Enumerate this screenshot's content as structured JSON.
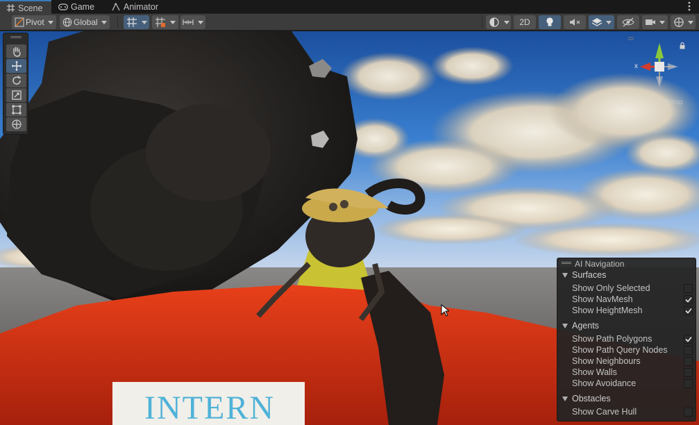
{
  "tabs": [
    {
      "label": "Scene",
      "icon": "grid-icon",
      "active": true
    },
    {
      "label": "Game",
      "icon": "gamepad-icon",
      "active": false
    },
    {
      "label": "Animator",
      "icon": "animator-icon",
      "active": false
    }
  ],
  "toolbar": {
    "pivot_label": "Pivot",
    "global_label": "Global",
    "mode_2d_label": "2D"
  },
  "scene": {
    "sign_text": "INTERN"
  },
  "ai_navigation": {
    "title": "AI Navigation",
    "sections": [
      {
        "label": "Surfaces",
        "options": [
          {
            "label": "Show Only Selected",
            "checked": false
          },
          {
            "label": "Show NavMesh",
            "checked": true
          },
          {
            "label": "Show HeightMesh",
            "checked": true
          }
        ]
      },
      {
        "label": "Agents",
        "options": [
          {
            "label": "Show Path Polygons",
            "checked": true
          },
          {
            "label": "Show Path Query Nodes",
            "checked": false
          },
          {
            "label": "Show Neighbours",
            "checked": false
          },
          {
            "label": "Show Walls",
            "checked": false
          },
          {
            "label": "Show Avoidance",
            "checked": false
          }
        ]
      },
      {
        "label": "Obstacles",
        "options": [
          {
            "label": "Show Carve Hull",
            "checked": false
          }
        ]
      }
    ]
  },
  "gizmo": {
    "x_label": "x",
    "persp_label": "< Persp"
  },
  "colors": {
    "accent": "#3a79bb",
    "selected_button": "#46607c",
    "panel": "#3c3c3c",
    "tab_bg": "#191919"
  }
}
